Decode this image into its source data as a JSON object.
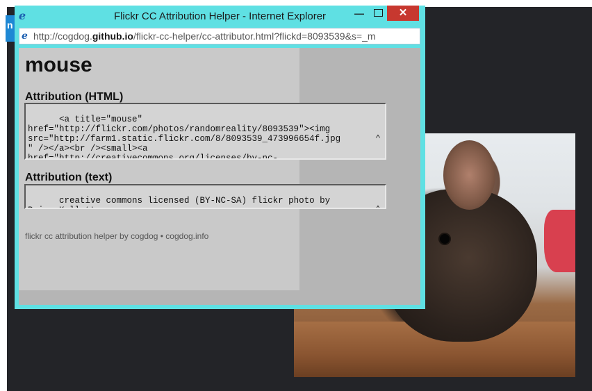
{
  "window": {
    "title": "Flickr CC Attribution Helper - Internet Explorer",
    "minimize_glyph": "—",
    "close_glyph": "✕",
    "logo_glyph": "e"
  },
  "address": {
    "prefix": "http://cogdog.",
    "host": "github.io",
    "path": "/flickr-cc-helper/cc-attributor.html?flickd=8093539&s=_m"
  },
  "page": {
    "title": "mouse",
    "html_heading": "Attribution (HTML)",
    "html_code": "<a title=\"mouse\"\nhref=\"http://flickr.com/photos/randomreality/8093539\"><img\nsrc=\"http://farm1.static.flickr.com/8/8093539_473996654f.jpg\n\" /></a><br /><small><a\nhref=\"http://creativecommons.org/licenses/by-nc-",
    "text_heading": "Attribution (text)",
    "text_code": "creative commons licensed (BY-NC-SA) flickr photo by\nBrian_Kellett:",
    "footer": "flickr cc attribution helper by cogdog • cogdog.info"
  },
  "background": {
    "tab_letter": "n"
  },
  "scroll": {
    "up": "⌃",
    "down": "⌄"
  },
  "colors": {
    "window_frame": "#5fe0e3",
    "close_button": "#c7382f",
    "ie_blue": "#1b5fb0"
  }
}
